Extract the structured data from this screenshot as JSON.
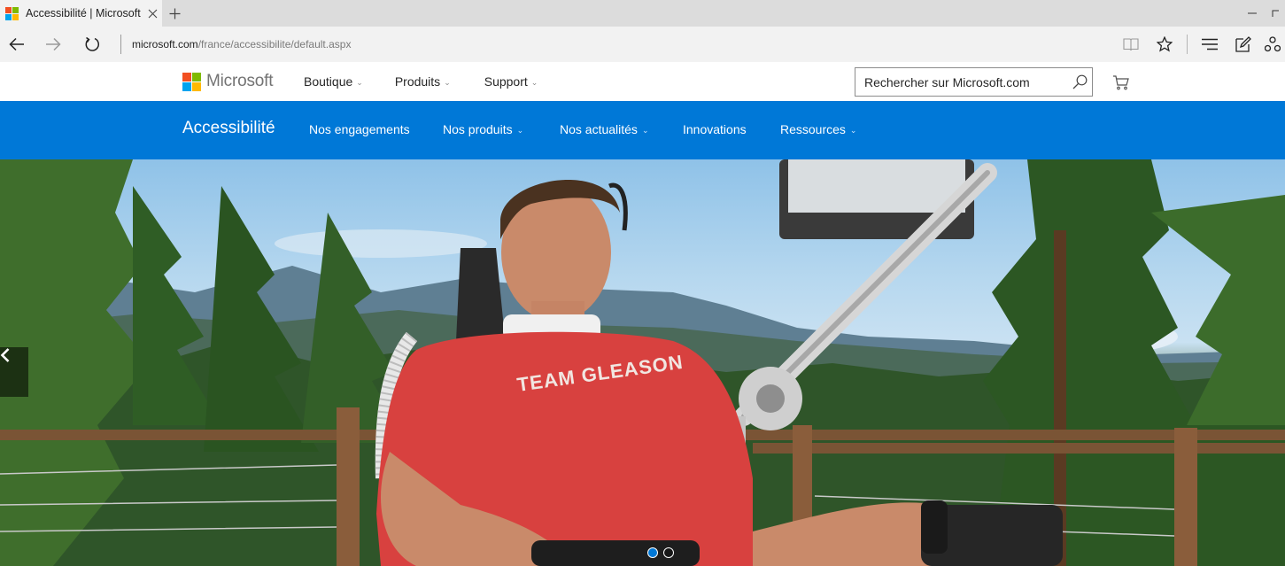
{
  "browser": {
    "tab_title": "Accessibilité | Microsoft",
    "url_host": "microsoft.com",
    "url_path": "/france/accessibilite/default.aspx"
  },
  "header": {
    "brand": "Microsoft",
    "nav": [
      {
        "label": "Boutique",
        "has_dropdown": true
      },
      {
        "label": "Produits",
        "has_dropdown": true
      },
      {
        "label": "Support",
        "has_dropdown": true
      }
    ],
    "search_placeholder": "Rechercher sur Microsoft.com"
  },
  "a11y_nav": {
    "title": "Accessibilité",
    "links": [
      {
        "label": "Nos engagements",
        "has_dropdown": false
      },
      {
        "label": "Nos produits",
        "has_dropdown": true
      },
      {
        "label": "Nos actualités",
        "has_dropdown": true
      },
      {
        "label": "Innovations",
        "has_dropdown": false
      },
      {
        "label": "Ressources",
        "has_dropdown": true
      }
    ]
  },
  "hero": {
    "shirt_text": "TEAM GLEASON",
    "slide_count": 2,
    "active_slide": 1
  },
  "colors": {
    "accent_blue": "#0078d7",
    "ms_red": "#f25022",
    "ms_green": "#7fba00",
    "ms_blue": "#00a4ef",
    "ms_yellow": "#ffb900"
  },
  "icons": {
    "tab_favicon": "microsoft-logo-icon",
    "tab_close": "close-icon",
    "new_tab": "plus-icon",
    "back": "back-arrow-icon",
    "forward": "forward-arrow-icon",
    "refresh": "refresh-icon",
    "reading_view": "book-icon",
    "favorites": "star-icon",
    "hub": "hub-icon",
    "notes": "web-note-icon",
    "share": "share-icon",
    "search": "search-icon",
    "cart": "cart-icon",
    "carousel_prev": "chevron-left-icon"
  }
}
